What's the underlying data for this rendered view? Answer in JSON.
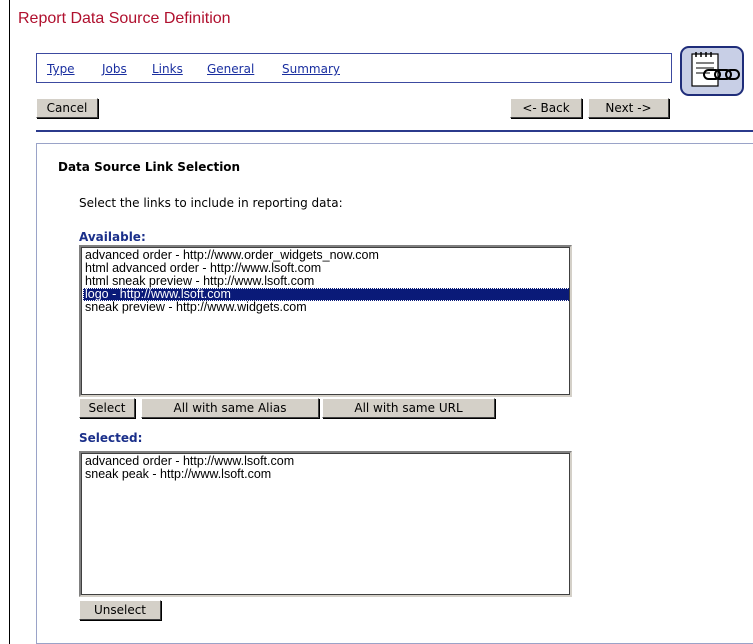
{
  "window": {
    "title": "Report Data Source Definition"
  },
  "tabs": [
    {
      "label": "Type"
    },
    {
      "label": "Jobs"
    },
    {
      "label": "Links"
    },
    {
      "label": "General"
    },
    {
      "label": "Summary"
    }
  ],
  "icon": {
    "name": "report-link-chain-icon"
  },
  "toolbar": {
    "cancel_label": "Cancel",
    "back_label": "<- Back",
    "next_label": "Next ->"
  },
  "section": {
    "title": "Data Source Link Selection",
    "instructions": "Select the links to include in reporting data:"
  },
  "available": {
    "label": "Available:",
    "items": [
      {
        "text": "advanced order - http://www.order_widgets_now.com",
        "selected": false
      },
      {
        "text": "html advanced order - http://www.lsoft.com",
        "selected": false
      },
      {
        "text": "html sneak preview - http://www.lsoft.com",
        "selected": false
      },
      {
        "text": "logo - http://www.lsoft.com",
        "selected": true
      },
      {
        "text": "sneak preview - http://www.widgets.com",
        "selected": false
      }
    ],
    "buttons": {
      "select_label": "Select",
      "alias_label": "All with same Alias",
      "url_label": "All with same URL"
    }
  },
  "selected": {
    "label": "Selected:",
    "items": [
      {
        "text": "advanced order - http://www.lsoft.com"
      },
      {
        "text": "sneak peak - http://www.lsoft.com"
      }
    ],
    "unselect_label": "Unselect"
  },
  "colors": {
    "title": "#b0102e",
    "link": "#1a2fa0",
    "highlight": "#0a1a78",
    "accent_border": "#1f2d7a"
  }
}
